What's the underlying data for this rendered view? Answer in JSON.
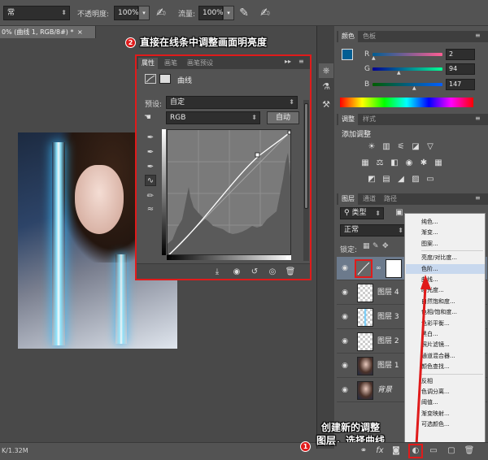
{
  "options_bar": {
    "mode_value": "常",
    "opacity_label": "不透明度:",
    "opacity_value": "100%",
    "flow_label": "流量:",
    "flow_value": "100%"
  },
  "document": {
    "tab_title": "0% (曲线 1, RGB/8#) *",
    "close_glyph": "×",
    "status_text": "K/1.32M"
  },
  "properties_dialog": {
    "tabs": [
      "属性",
      "画笔",
      "画笔预设"
    ],
    "header_label": "曲线",
    "preset_label": "预设:",
    "preset_value": "自定",
    "channel_value": "RGB",
    "auto_label": "自动"
  },
  "annotations": {
    "step1_number": "1",
    "step1_text_line1": "创建新的调整",
    "step1_text_line2": "图层，选择曲线",
    "step2_number": "2",
    "step2_text": "直接在线条中调整画面明亮度"
  },
  "color_panel": {
    "tabs": [
      "颜色",
      "色板"
    ],
    "r_label": "R",
    "g_label": "G",
    "b_label": "B",
    "r_value": "2",
    "g_value": "94",
    "b_value": "147",
    "foreground_color": "#025e93"
  },
  "adjustments_panel": {
    "tabs": [
      "调整",
      "样式"
    ],
    "add_label": "添加调整"
  },
  "layers_panel": {
    "tabs": [
      "图层",
      "通道",
      "路径"
    ],
    "filter_value": "类型",
    "blend_value": "正常",
    "lock_label": "锁定:",
    "layers": [
      {
        "name": "",
        "selected": true
      },
      {
        "name": "图层 4",
        "selected": false
      },
      {
        "name": "图层 3",
        "selected": false
      },
      {
        "name": "图层 2",
        "selected": false
      },
      {
        "name": "图层 1",
        "selected": false
      },
      {
        "name": "背景",
        "selected": false
      }
    ]
  },
  "adjustment_menu": {
    "items": [
      "纯色...",
      "渐变...",
      "图案...",
      "亮度/对比度...",
      "色阶...",
      "曲线...",
      "曝光度...",
      "自然饱和度...",
      "色相/饱和度...",
      "色彩平衡...",
      "黑白...",
      "照片滤镜...",
      "通道混合器...",
      "颜色查找...",
      "反相",
      "色调分离...",
      "阈值...",
      "渐变映射...",
      "可选颜色..."
    ],
    "highlighted": "色阶..."
  }
}
